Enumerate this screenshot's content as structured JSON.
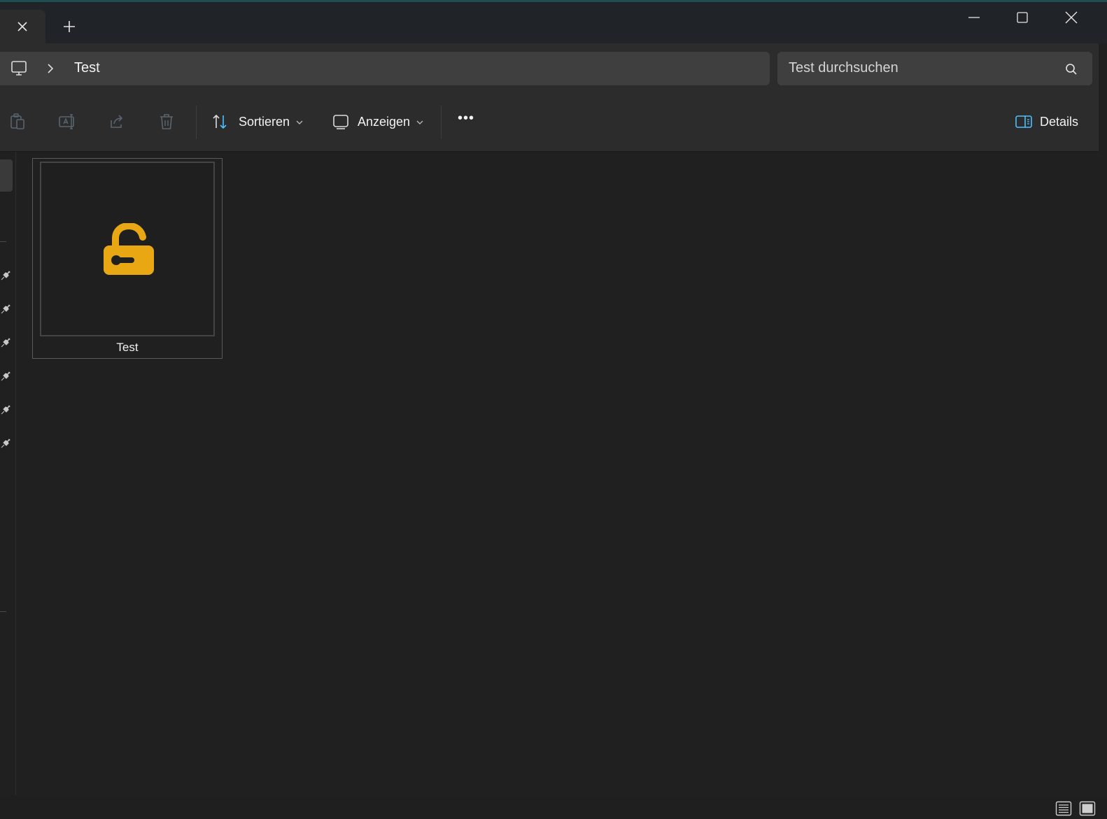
{
  "window": {
    "tabs": [
      {
        "label": ""
      }
    ],
    "controls": [
      "minimize",
      "maximize",
      "close"
    ]
  },
  "address_bar": {
    "breadcrumb": [
      "Test"
    ],
    "icon": "computer-icon"
  },
  "search": {
    "placeholder": "Test durchsuchen"
  },
  "toolbar": {
    "disabled_actions": [
      "paste-icon",
      "rename-icon",
      "share-icon",
      "delete-icon"
    ],
    "sort_label": "Sortieren",
    "view_label": "Anzeigen",
    "more_label": "•••",
    "details_label": "Details"
  },
  "files": [
    {
      "name": "Test",
      "icon": "unlocked-padlock-icon",
      "icon_color": "#e8a713"
    }
  ],
  "colors": {
    "accent": "#4cc2ff",
    "background": "#202020",
    "lock": "#e8a713"
  }
}
